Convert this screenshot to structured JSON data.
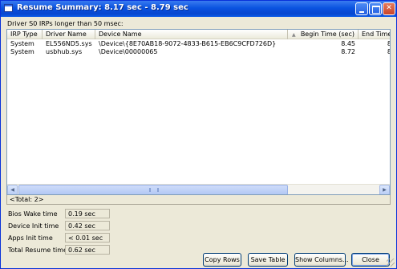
{
  "window": {
    "title": "Resume Summary: 8.17 sec - 8.79 sec"
  },
  "caption": "Driver S0 IRPs longer than 50 msec:",
  "table": {
    "columns": [
      "IRP Type",
      "Driver Name",
      "Device Name",
      "Begin Time (sec)",
      "End Time (s"
    ],
    "sort_column": "Begin Time (sec)",
    "rows": [
      [
        "System",
        "EL556ND5.sys",
        "\\Device\\{8E70AB18-9072-4833-B615-EB6C9CFD726D}",
        "8.45",
        "8"
      ],
      [
        "System",
        "usbhub.sys",
        "\\Device\\00000065",
        "8.72",
        "8"
      ]
    ],
    "total": "<Total: 2>"
  },
  "stats": [
    {
      "label": "Bios Wake time",
      "value": "0.19 sec"
    },
    {
      "label": "Device Init time",
      "value": "0.42 sec"
    },
    {
      "label": "Apps Init time",
      "value": "< 0.01 sec"
    },
    {
      "label": "Total Resume time",
      "value": "0.62 sec"
    }
  ],
  "buttons": {
    "copy_rows": "Copy Rows",
    "save_table": "Save Table",
    "show_columns": "Show Columns...",
    "close": "Close"
  },
  "colors": {
    "title_bar": "#0a53e0",
    "dialog_bg": "#ece9d8",
    "list_bg": "#ffffff"
  }
}
